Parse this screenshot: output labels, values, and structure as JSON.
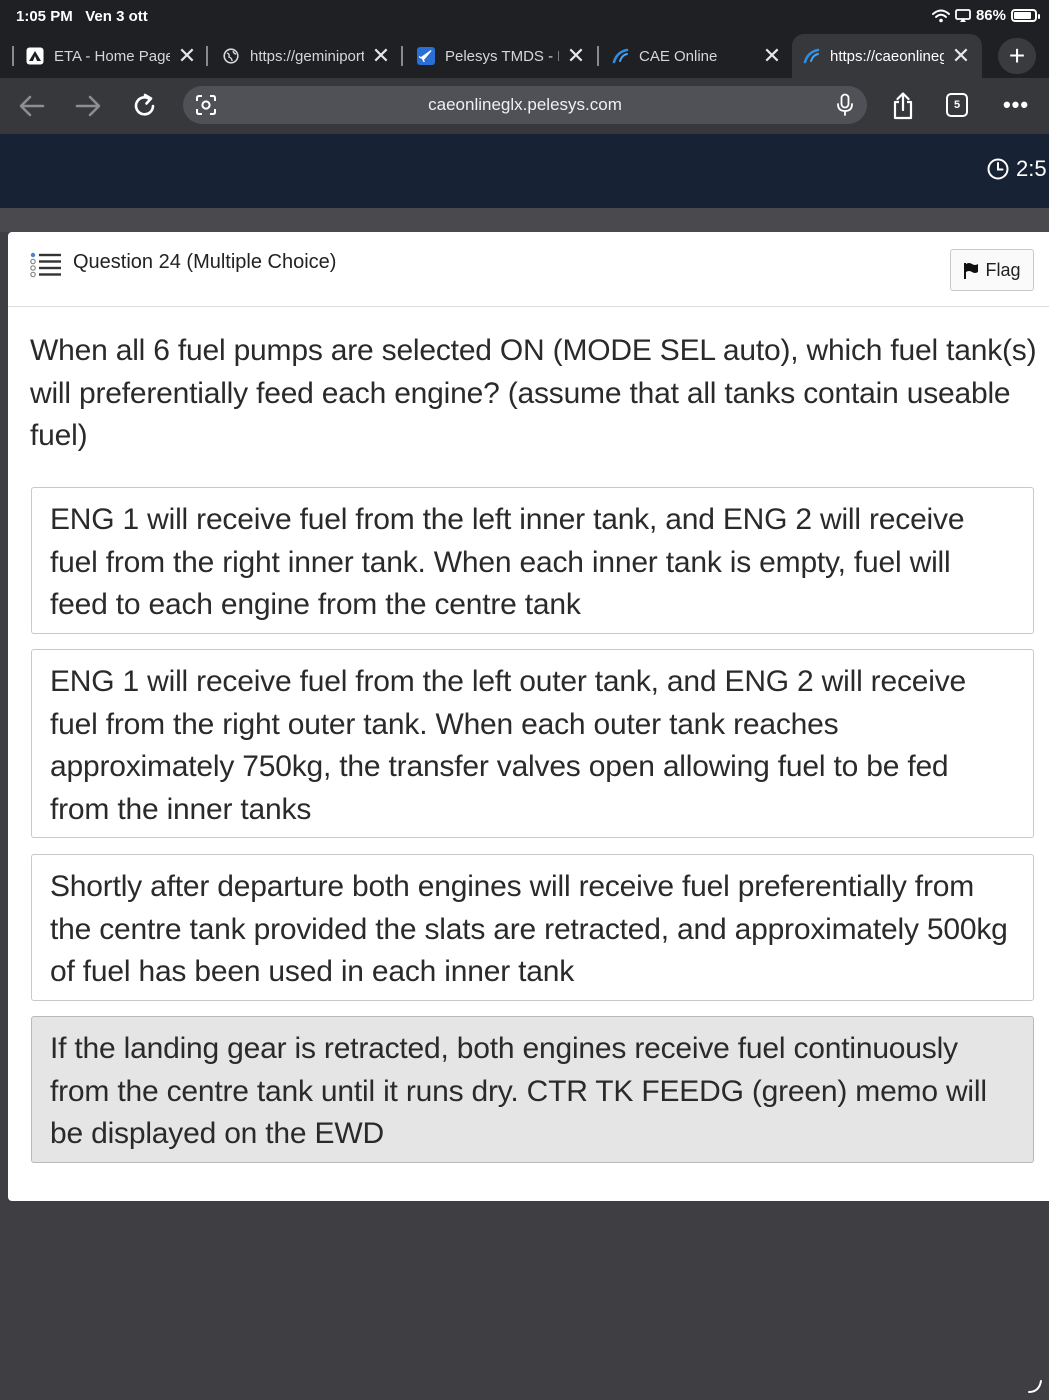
{
  "status_bar": {
    "time": "1:05 PM",
    "date": "Ven 3 ott",
    "battery": "86%",
    "battery_level": 0.86
  },
  "tabs": [
    {
      "title": "ETA - Home Page",
      "active": false
    },
    {
      "title": "https://geminiportal",
      "active": false
    },
    {
      "title": "Pelesys TMDS - Home",
      "active": false
    },
    {
      "title": "CAE Online",
      "active": false
    },
    {
      "title": "https://caeonlineglx",
      "active": true
    }
  ],
  "toolbar": {
    "url": "caeonlineglx.pelesys.com",
    "tab_count": "5"
  },
  "site_header": {
    "timer": "2:5"
  },
  "question": {
    "title": "Question 24 (Multiple Choice)",
    "flag_label": "Flag",
    "text": "When all 6 fuel pumps are selected ON (MODE SEL auto), which fuel tank(s) will preferentially feed each engine? (assume that all tanks contain useable fuel)",
    "options": [
      {
        "text": "ENG 1 will receive fuel from the left inner tank, and ENG 2 will receive fuel from the right inner tank. When each inner tank is empty, fuel will feed to each engine from the centre tank",
        "selected": false
      },
      {
        "text": "ENG 1 will receive fuel from the left outer tank, and ENG 2 will receive fuel from the right outer tank. When each outer tank reaches approximately 750kg, the transfer valves open allowing fuel to be fed from the inner tanks",
        "selected": false
      },
      {
        "text": "Shortly after departure both engines will receive fuel preferentially from the centre tank provided the slats are retracted, and approximately 500kg of fuel has been used in each inner tank",
        "selected": false
      },
      {
        "text": "If the landing gear is retracted, both engines receive fuel continuously from the centre tank until it runs dry. CTR TK FEEDG (green) memo will be displayed on the EWD",
        "selected": true
      }
    ]
  },
  "colors": {
    "browser_chrome": "#1f2023",
    "toolbar": "#37383c",
    "site_header": "#172234",
    "selected_option": "#e5e5e5"
  }
}
